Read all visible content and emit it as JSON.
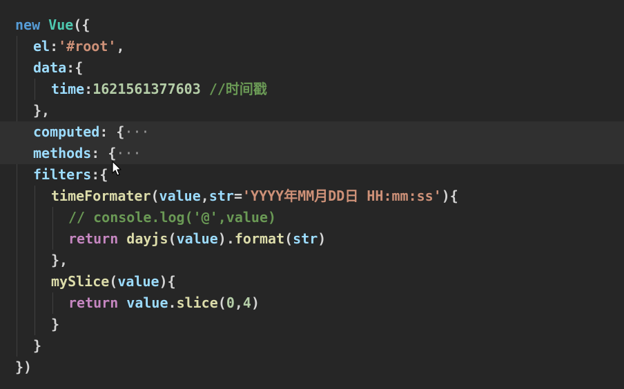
{
  "editor": {
    "lines": [
      {
        "tokens": [
          {
            "t": "new",
            "c": "kw"
          },
          {
            "t": " "
          },
          {
            "t": "Vue",
            "c": "cls"
          },
          {
            "t": "({",
            "c": "punc"
          }
        ]
      },
      {
        "tokens": [
          {
            "t": "el",
            "c": "prop"
          },
          {
            "t": ":",
            "c": "punc"
          },
          {
            "t": "'#root'",
            "c": "str"
          },
          {
            "t": ",",
            "c": "punc"
          }
        ]
      },
      {
        "tokens": [
          {
            "t": "data",
            "c": "prop"
          },
          {
            "t": ":{",
            "c": "punc"
          }
        ]
      },
      {
        "tokens": [
          {
            "t": "time",
            "c": "prop"
          },
          {
            "t": ":",
            "c": "punc"
          },
          {
            "t": "1621561377603",
            "c": "num"
          },
          {
            "t": " "
          },
          {
            "t": "//时间戳",
            "c": "cmt"
          }
        ]
      },
      {
        "tokens": [
          {
            "t": "},",
            "c": "punc"
          }
        ]
      },
      {
        "tokens": [
          {
            "t": "computed",
            "c": "prop"
          },
          {
            "t": ": {",
            "c": "punc"
          },
          {
            "t": "···",
            "c": "ell"
          }
        ]
      },
      {
        "tokens": [
          {
            "t": "methods",
            "c": "prop"
          },
          {
            "t": ": {",
            "c": "punc"
          },
          {
            "t": "···",
            "c": "ell"
          }
        ]
      },
      {
        "tokens": [
          {
            "t": "filters",
            "c": "prop"
          },
          {
            "t": ":{",
            "c": "punc"
          }
        ]
      },
      {
        "tokens": [
          {
            "t": "timeFormater",
            "c": "fn"
          },
          {
            "t": "(",
            "c": "punc"
          },
          {
            "t": "value",
            "c": "prop"
          },
          {
            "t": ",",
            "c": "punc"
          },
          {
            "t": "str",
            "c": "prop"
          },
          {
            "t": "=",
            "c": "punc"
          },
          {
            "t": "'YYYY年MM月DD日 HH:mm:ss'",
            "c": "str"
          },
          {
            "t": "){",
            "c": "punc"
          }
        ]
      },
      {
        "tokens": [
          {
            "t": "// console.log('@',value)",
            "c": "cmt"
          }
        ]
      },
      {
        "tokens": [
          {
            "t": "return",
            "c": "ctrl"
          },
          {
            "t": " "
          },
          {
            "t": "dayjs",
            "c": "fn"
          },
          {
            "t": "(",
            "c": "punc"
          },
          {
            "t": "value",
            "c": "prop"
          },
          {
            "t": ").",
            "c": "punc"
          },
          {
            "t": "format",
            "c": "fn"
          },
          {
            "t": "(",
            "c": "punc"
          },
          {
            "t": "str",
            "c": "prop"
          },
          {
            "t": ")",
            "c": "punc"
          }
        ]
      },
      {
        "tokens": [
          {
            "t": "},",
            "c": "punc"
          }
        ]
      },
      {
        "tokens": [
          {
            "t": "mySlice",
            "c": "fn"
          },
          {
            "t": "(",
            "c": "punc"
          },
          {
            "t": "value",
            "c": "prop"
          },
          {
            "t": "){",
            "c": "punc"
          }
        ]
      },
      {
        "tokens": [
          {
            "t": "return",
            "c": "ctrl"
          },
          {
            "t": " "
          },
          {
            "t": "value",
            "c": "prop"
          },
          {
            "t": ".",
            "c": "punc"
          },
          {
            "t": "slice",
            "c": "fn"
          },
          {
            "t": "(",
            "c": "punc"
          },
          {
            "t": "0",
            "c": "num"
          },
          {
            "t": ",",
            "c": "punc"
          },
          {
            "t": "4",
            "c": "num"
          },
          {
            "t": ")",
            "c": "punc"
          }
        ]
      },
      {
        "tokens": [
          {
            "t": "}",
            "c": "punc"
          }
        ]
      },
      {
        "tokens": [
          {
            "t": "}",
            "c": "punc"
          }
        ]
      },
      {
        "tokens": [
          {
            "t": "})",
            "c": "punc"
          }
        ]
      }
    ]
  },
  "colors": {
    "background": "#262626",
    "highlight": "#303030",
    "keyword": "#569cd6",
    "control": "#c586c0",
    "class": "#4ec9b0",
    "property": "#9cdcfe",
    "number": "#b5cea8",
    "string": "#ce9178",
    "function": "#dcdcaa",
    "comment": "#6a9955"
  },
  "icons": {
    "cursor": "mouse-pointer-icon",
    "fold": "fold-ellipsis-icon"
  }
}
